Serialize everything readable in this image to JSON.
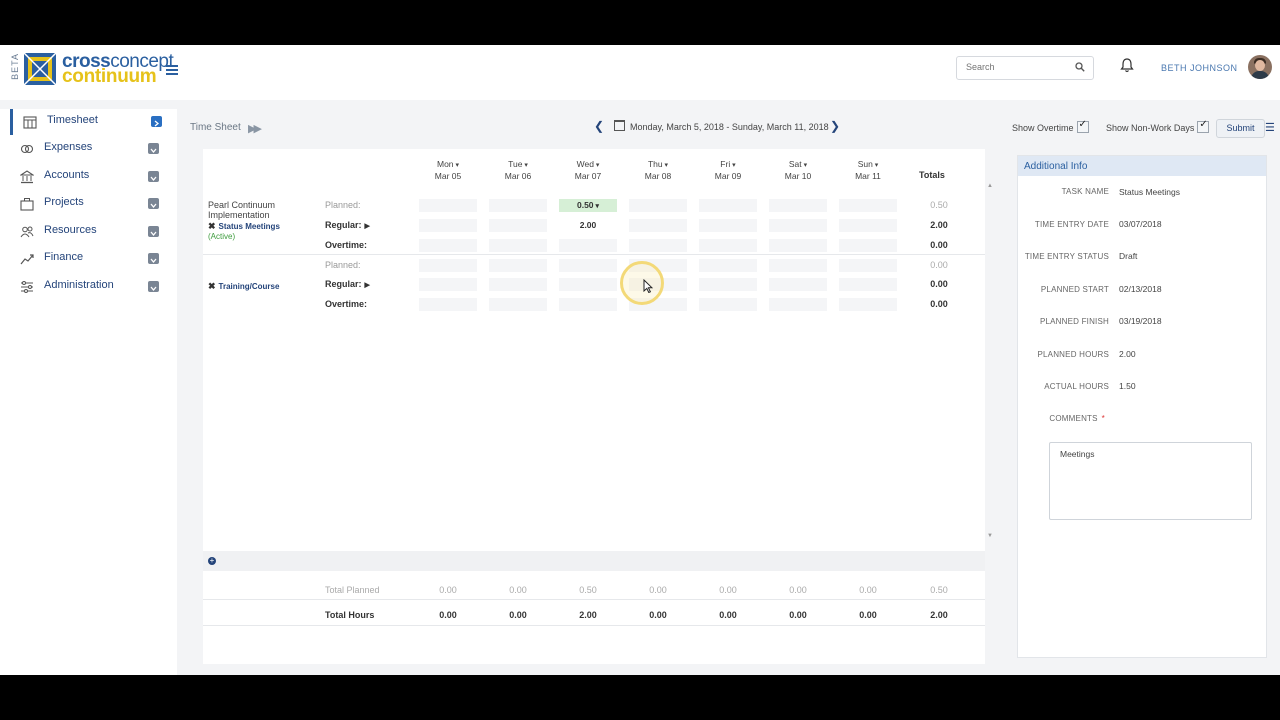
{
  "app": {
    "badge": "BETA",
    "logo_line1_a": "cross",
    "logo_line1_b": "concept",
    "logo_line2": "continuum",
    "search_placeholder": "Search",
    "user_name": "BETH JOHNSON"
  },
  "sidebar": {
    "items": [
      {
        "label": "Timesheet",
        "icon": "timesheet-icon"
      },
      {
        "label": "Expenses",
        "icon": "expenses-icon"
      },
      {
        "label": "Accounts",
        "icon": "accounts-icon"
      },
      {
        "label": "Projects",
        "icon": "projects-icon"
      },
      {
        "label": "Resources",
        "icon": "resources-icon"
      },
      {
        "label": "Finance",
        "icon": "finance-icon"
      },
      {
        "label": "Administration",
        "icon": "administration-icon"
      }
    ],
    "active_index": 0
  },
  "toolbar": {
    "title": "Time Sheet",
    "date_range": "Monday, March 5, 2018 - Sunday, March 11, 2018",
    "show_overtime": "Show Overtime",
    "show_non_work_days": "Show Non-Work Days",
    "submit": "Submit"
  },
  "grid": {
    "days": [
      {
        "name": "Mon",
        "date": "Mar 05"
      },
      {
        "name": "Tue",
        "date": "Mar 06"
      },
      {
        "name": "Wed",
        "date": "Mar 07"
      },
      {
        "name": "Thu",
        "date": "Mar 08"
      },
      {
        "name": "Fri",
        "date": "Mar 09"
      },
      {
        "name": "Sat",
        "date": "Mar 10"
      },
      {
        "name": "Sun",
        "date": "Mar 11"
      }
    ],
    "totals_header": "Totals",
    "tasks": [
      {
        "project": "Pearl Continuum Implementation",
        "project_line1": "Pearl Continuum",
        "project_line2": "Implementation",
        "name": "Status Meetings",
        "status": "(Active)",
        "planned_label": "Planned:",
        "regular_label": "Regular:",
        "overtime_label": "Overtime:",
        "planned": [
          "",
          "",
          "0.50",
          "",
          "",
          "",
          ""
        ],
        "regular": [
          "",
          "",
          "2.00",
          "",
          "",
          "",
          ""
        ],
        "overtime": [
          "",
          "",
          "",
          "",
          "",
          "",
          ""
        ],
        "planned_total": "0.50",
        "regular_total": "2.00",
        "overtime_total": "0.00"
      },
      {
        "project": "",
        "name": "Training/Course",
        "status": "",
        "planned_label": "Planned:",
        "regular_label": "Regular:",
        "overtime_label": "Overtime:",
        "planned": [
          "",
          "",
          "",
          "",
          "",
          "",
          ""
        ],
        "regular": [
          "",
          "",
          "",
          "",
          "",
          "",
          ""
        ],
        "overtime": [
          "",
          "",
          "",
          "",
          "",
          "",
          ""
        ],
        "planned_total": "0.00",
        "regular_total": "0.00",
        "overtime_total": "0.00"
      }
    ],
    "summary": {
      "total_planned_label": "Total Planned",
      "total_planned": [
        "0.00",
        "0.00",
        "0.50",
        "0.00",
        "0.00",
        "0.00",
        "0.00"
      ],
      "total_planned_sum": "0.50",
      "total_hours_label": "Total Hours",
      "total_hours": [
        "0.00",
        "0.00",
        "2.00",
        "0.00",
        "0.00",
        "0.00",
        "0.00"
      ],
      "total_hours_sum": "2.00"
    }
  },
  "additional_info": {
    "title": "Additional Info",
    "fields": [
      {
        "label": "TASK NAME",
        "value": "Status Meetings"
      },
      {
        "label": "TIME ENTRY DATE",
        "value": "03/07/2018"
      },
      {
        "label": "TIME ENTRY STATUS",
        "value": "Draft"
      },
      {
        "label": "PLANNED START",
        "value": "02/13/2018"
      },
      {
        "label": "PLANNED FINISH",
        "value": "03/19/2018"
      },
      {
        "label": "PLANNED HOURS",
        "value": "2.00"
      },
      {
        "label": "ACTUAL HOURS",
        "value": "1.50"
      }
    ],
    "comments_label": "COMMENTS",
    "comments_required": "*",
    "comments_value": "Meetings"
  }
}
